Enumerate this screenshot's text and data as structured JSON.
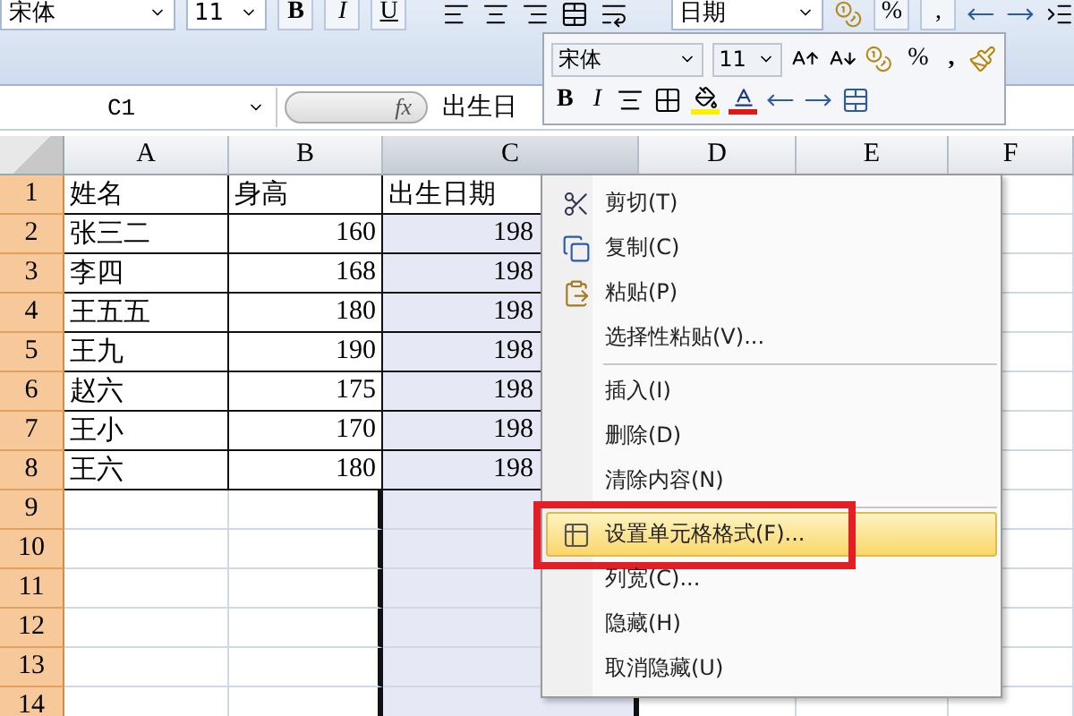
{
  "ribbon": {
    "font": "宋体",
    "size": "11",
    "bold": "B",
    "italic": "I",
    "underline": "U",
    "number_format": "日期",
    "percent": "%",
    "comma": ","
  },
  "formula_bar": {
    "name_box": "C1",
    "fx": "fx",
    "formula": "出生日"
  },
  "sheet": {
    "columns": [
      {
        "label": "A",
        "selected": false
      },
      {
        "label": "B",
        "selected": false
      },
      {
        "label": "C",
        "selected": true
      },
      {
        "label": "D",
        "selected": false
      },
      {
        "label": "E",
        "selected": false
      },
      {
        "label": "F",
        "selected": false
      }
    ],
    "rows": [
      {
        "label": "1",
        "cells": [
          "姓名",
          "身高",
          "出生日期"
        ]
      },
      {
        "label": "2",
        "cells": [
          "张三二",
          "160",
          "198"
        ]
      },
      {
        "label": "3",
        "cells": [
          "李四",
          "168",
          "198"
        ]
      },
      {
        "label": "4",
        "cells": [
          "王五五",
          "180",
          "198"
        ]
      },
      {
        "label": "5",
        "cells": [
          "王九",
          "190",
          "198"
        ]
      },
      {
        "label": "6",
        "cells": [
          "赵六",
          "175",
          "198"
        ]
      },
      {
        "label": "7",
        "cells": [
          "王小",
          "170",
          "198"
        ]
      },
      {
        "label": "8",
        "cells": [
          "王六",
          "180",
          "198"
        ]
      },
      {
        "label": "9",
        "cells": []
      },
      {
        "label": "10",
        "cells": []
      },
      {
        "label": "11",
        "cells": []
      },
      {
        "label": "12",
        "cells": []
      },
      {
        "label": "13",
        "cells": []
      },
      {
        "label": "14",
        "cells": []
      }
    ]
  },
  "mini_toolbar": {
    "font": "宋体",
    "size": "11",
    "percent": "%",
    "comma": ",",
    "bold": "B",
    "italic": "I"
  },
  "context_menu": {
    "groups": [
      [
        {
          "label": "剪切(T)",
          "selected": false
        },
        {
          "label": "复制(C)",
          "selected": false
        },
        {
          "label": "粘贴(P)",
          "selected": false
        },
        {
          "label": "选择性粘贴(V)...",
          "selected": false
        }
      ],
      [
        {
          "label": "插入(I)",
          "selected": false
        },
        {
          "label": "删除(D)",
          "selected": false
        },
        {
          "label": "清除内容(N)",
          "selected": false
        }
      ],
      [
        {
          "label": "设置单元格格式(F)...",
          "selected": true,
          "marked": true
        },
        {
          "label": "列宽(C)...",
          "selected": false
        },
        {
          "label": "隐藏(H)",
          "selected": false
        },
        {
          "label": "取消隐藏(U)",
          "selected": false
        }
      ]
    ]
  }
}
